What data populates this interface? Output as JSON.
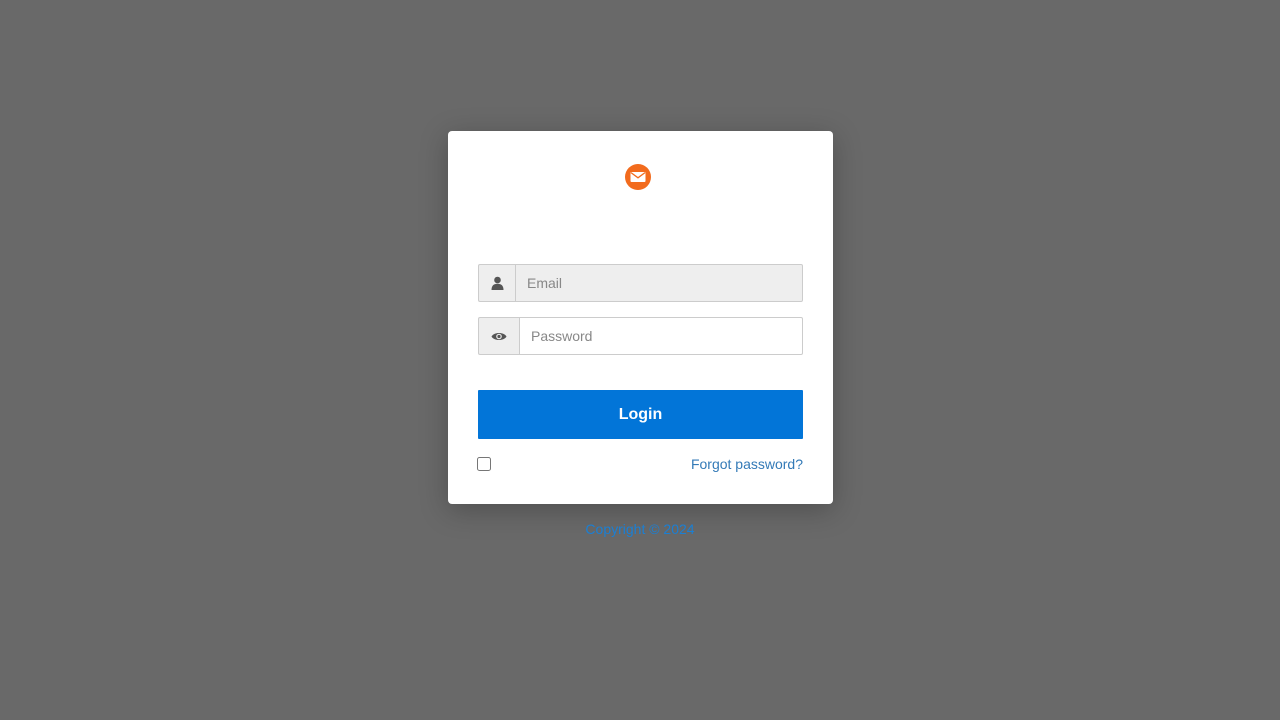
{
  "brand": {
    "logo_icon": "envelope-icon",
    "logo_color": "#f26b1d"
  },
  "form": {
    "email_placeholder": "Email",
    "email_value": "",
    "email_icon": "user-icon",
    "password_placeholder": "Password",
    "password_value": "",
    "password_icon": "eye-icon",
    "login_label": "Login",
    "remember_checked": false,
    "forgot_label": "Forgot password?"
  },
  "footer": {
    "copyright": "Copyright © 2024"
  },
  "colors": {
    "background": "#696969",
    "primary": "#0275d8",
    "link": "#337ab7"
  }
}
